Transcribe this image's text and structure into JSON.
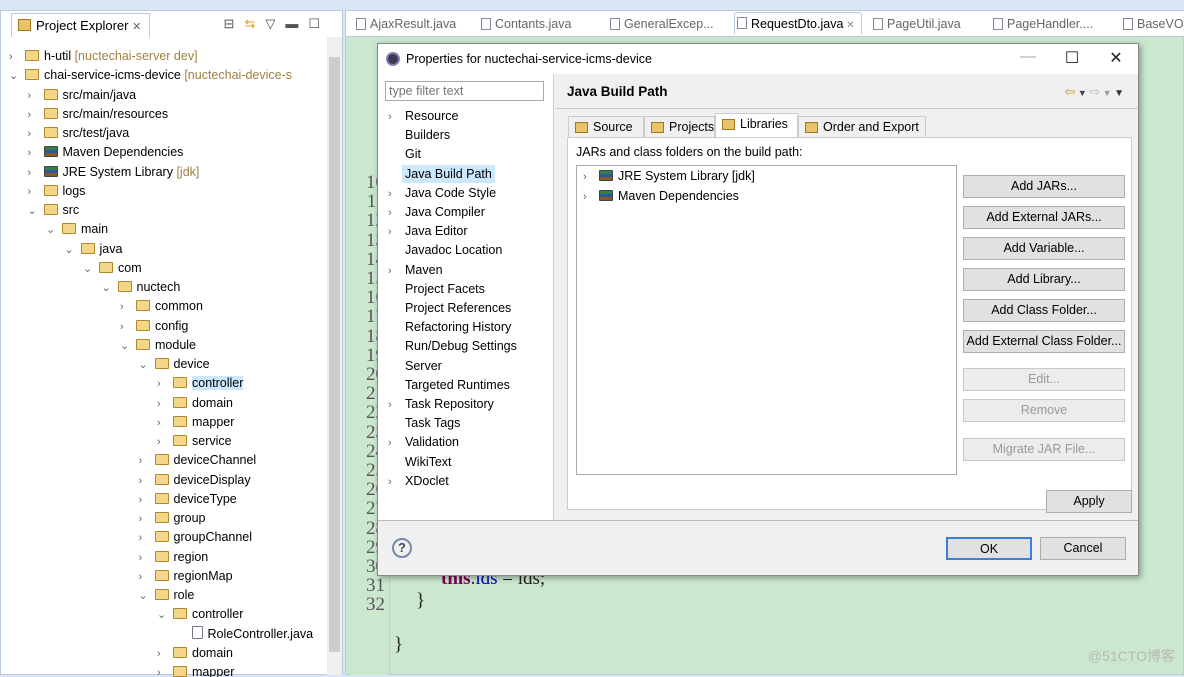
{
  "explorer": {
    "title": "Project Explorer",
    "close": "✕",
    "toolbar_icons": [
      "collapse-all-icon",
      "link-editor-icon",
      "view-menu-icon",
      "minimize-icon",
      "maximize-icon"
    ],
    "items": [
      {
        "label": "h-util",
        "deco": "[nuctechai-server dev]",
        "level": 0,
        "chev": ">",
        "icon": "project-icon"
      },
      {
        "label": "chai-service-icms-device",
        "deco": "[nuctechai-device-s",
        "level": 0,
        "chev": "v",
        "icon": "project-icon"
      },
      {
        "label": "src/main/java",
        "level": 1,
        "chev": ">",
        "icon": "source-folder-icon"
      },
      {
        "label": "src/main/resources",
        "level": 1,
        "chev": ">",
        "icon": "source-folder-icon"
      },
      {
        "label": "src/test/java",
        "level": 1,
        "chev": ">",
        "icon": "source-folder-icon"
      },
      {
        "label": "Maven Dependencies",
        "level": 1,
        "chev": ">",
        "icon": "library-icon"
      },
      {
        "label": "JRE System Library",
        "deco": "[jdk]",
        "level": 1,
        "chev": ">",
        "icon": "library-icon"
      },
      {
        "label": "logs",
        "level": 1,
        "chev": ">",
        "icon": "folder-icon"
      },
      {
        "label": "src",
        "level": 1,
        "chev": "v",
        "icon": "folder-icon"
      },
      {
        "label": "main",
        "level": 2,
        "chev": "v",
        "icon": "folder-icon"
      },
      {
        "label": "java",
        "level": 3,
        "chev": "v",
        "icon": "folder-icon"
      },
      {
        "label": "com",
        "level": 4,
        "chev": "v",
        "icon": "folder-icon"
      },
      {
        "label": "nuctech",
        "level": 5,
        "chev": "v",
        "icon": "folder-icon"
      },
      {
        "label": "common",
        "level": 6,
        "chev": ">",
        "icon": "folder-icon"
      },
      {
        "label": "config",
        "level": 6,
        "chev": ">",
        "icon": "folder-icon"
      },
      {
        "label": "module",
        "level": 6,
        "chev": "v",
        "icon": "folder-icon"
      },
      {
        "label": "device",
        "level": 7,
        "chev": "v",
        "icon": "folder-icon"
      },
      {
        "label": "controller",
        "level": 8,
        "chev": ">",
        "icon": "folder-icon",
        "selected": true
      },
      {
        "label": "domain",
        "level": 8,
        "chev": ">",
        "icon": "folder-icon"
      },
      {
        "label": "mapper",
        "level": 8,
        "chev": ">",
        "icon": "folder-icon"
      },
      {
        "label": "service",
        "level": 8,
        "chev": ">",
        "icon": "folder-icon"
      },
      {
        "label": "deviceChannel",
        "level": 7,
        "chev": ">",
        "icon": "folder-icon"
      },
      {
        "label": "deviceDisplay",
        "level": 7,
        "chev": ">",
        "icon": "folder-icon"
      },
      {
        "label": "deviceType",
        "level": 7,
        "chev": ">",
        "icon": "folder-icon"
      },
      {
        "label": "group",
        "level": 7,
        "chev": ">",
        "icon": "folder-icon"
      },
      {
        "label": "groupChannel",
        "level": 7,
        "chev": ">",
        "icon": "folder-icon"
      },
      {
        "label": "region",
        "level": 7,
        "chev": ">",
        "icon": "folder-icon"
      },
      {
        "label": "regionMap",
        "level": 7,
        "chev": ">",
        "icon": "folder-icon"
      },
      {
        "label": "role",
        "level": 7,
        "chev": "v",
        "icon": "folder-icon"
      },
      {
        "label": "controller",
        "level": 8,
        "chev": "v",
        "icon": "folder-icon"
      },
      {
        "label": "RoleController.java",
        "level": 9,
        "chev": "",
        "icon": "java-file-icon"
      },
      {
        "label": "domain",
        "level": 8,
        "chev": ">",
        "icon": "folder-icon"
      },
      {
        "label": "mapper",
        "level": 8,
        "chev": ">",
        "icon": "folder-icon"
      }
    ]
  },
  "editor": {
    "tabs": [
      {
        "label": "AjaxResult.java"
      },
      {
        "label": "Contants.java"
      },
      {
        "label": "GeneralExcep..."
      },
      {
        "label": "RequestDto.java",
        "active": true
      },
      {
        "label": "PageUtil.java"
      },
      {
        "label": "PageHandler...."
      },
      {
        "label": "BaseVO"
      }
    ],
    "line_numbers": [
      "10",
      "11",
      "12",
      "13",
      "14",
      "15",
      "16",
      "17",
      "18",
      "19",
      "20",
      "21",
      "22",
      "23",
      "24",
      "25",
      "26",
      "27",
      "28",
      "29",
      "30",
      "31",
      "32"
    ],
    "code": {
      "line28_kw": "this",
      "line28_dot": ".",
      "line28_field": "ids",
      "line28_rest": " = ids;",
      "line29": "}",
      "line31": "}"
    },
    "background_color": "#cbe8cf"
  },
  "dialog": {
    "title": "Properties for nuctechai-service-icms-device",
    "filter_placeholder": "type filter text",
    "nav": [
      {
        "label": "Resource",
        "chev": ">"
      },
      {
        "label": "Builders"
      },
      {
        "label": "Git"
      },
      {
        "label": "Java Build Path",
        "selected": true
      },
      {
        "label": "Java Code Style",
        "chev": ">"
      },
      {
        "label": "Java Compiler",
        "chev": ">"
      },
      {
        "label": "Java Editor",
        "chev": ">"
      },
      {
        "label": "Javadoc Location"
      },
      {
        "label": "Maven",
        "chev": ">"
      },
      {
        "label": "Project Facets"
      },
      {
        "label": "Project References"
      },
      {
        "label": "Refactoring History"
      },
      {
        "label": "Run/Debug Settings"
      },
      {
        "label": "Server"
      },
      {
        "label": "Targeted Runtimes"
      },
      {
        "label": "Task Repository",
        "chev": ">"
      },
      {
        "label": "Task Tags"
      },
      {
        "label": "Validation",
        "chev": ">"
      },
      {
        "label": "WikiText"
      },
      {
        "label": "XDoclet",
        "chev": ">"
      }
    ],
    "page_title": "Java Build Path",
    "tabs": [
      {
        "label": "Source"
      },
      {
        "label": "Projects"
      },
      {
        "label": "Libraries",
        "active": true
      },
      {
        "label": "Order and Export"
      }
    ],
    "libs_label": "JARs and class folders on the build path:",
    "libs": [
      {
        "label": "JRE System Library [jdk]"
      },
      {
        "label": "Maven Dependencies"
      }
    ],
    "buttons": [
      {
        "label": "Add JARs..."
      },
      {
        "label": "Add External JARs..."
      },
      {
        "label": "Add Variable..."
      },
      {
        "label": "Add Library..."
      },
      {
        "label": "Add Class Folder..."
      },
      {
        "label": "Add External Class Folder..."
      },
      {
        "label": "Edit...",
        "disabled": true
      },
      {
        "label": "Remove",
        "disabled": true
      },
      {
        "label": "Migrate JAR File...",
        "disabled": true
      }
    ],
    "apply": "Apply",
    "ok": "OK",
    "cancel": "Cancel",
    "help": "?"
  },
  "watermark": "@51CTO博客"
}
